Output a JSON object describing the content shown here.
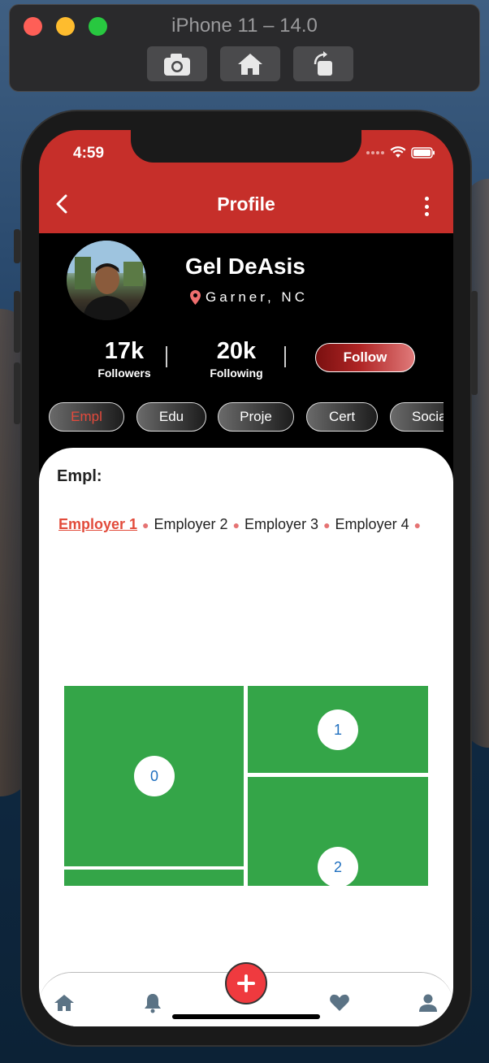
{
  "simulator": {
    "title": "iPhone 11 – 14.0",
    "tools": [
      {
        "icon": "camera-icon",
        "label": "Screenshot"
      },
      {
        "icon": "home-icon",
        "label": "Home"
      },
      {
        "icon": "rotate-icon",
        "label": "Rotate"
      }
    ]
  },
  "status_bar": {
    "time": "4:59"
  },
  "header": {
    "title": "Profile",
    "back_icon": "chevron-left-icon",
    "menu_icon": "more-vertical-icon"
  },
  "profile": {
    "name": "Gel DeAsis",
    "location": "Garner, NC",
    "followers_count": "17k",
    "followers_label": "Followers",
    "following_count": "20k",
    "following_label": "Following",
    "follow_button": "Follow"
  },
  "chips": [
    "Empl",
    "Edu",
    "Proje",
    "Cert",
    "Socia"
  ],
  "active_chip": "Empl",
  "section": {
    "title": "Empl:",
    "employers": [
      "Employer 1",
      "Employer 2",
      "Employer 3",
      "Employer 4"
    ],
    "active_employer": "Employer 1"
  },
  "tiles": [
    "0",
    "1",
    "2"
  ],
  "bottom_nav": [
    "home-icon",
    "bell-icon",
    "add-icon",
    "heart-icon",
    "person-icon"
  ],
  "colors": {
    "brand_red": "#c62f2a",
    "tile_green": "#34a548",
    "fab_red": "#ef3a3f",
    "number_blue": "#1f6fbf"
  }
}
